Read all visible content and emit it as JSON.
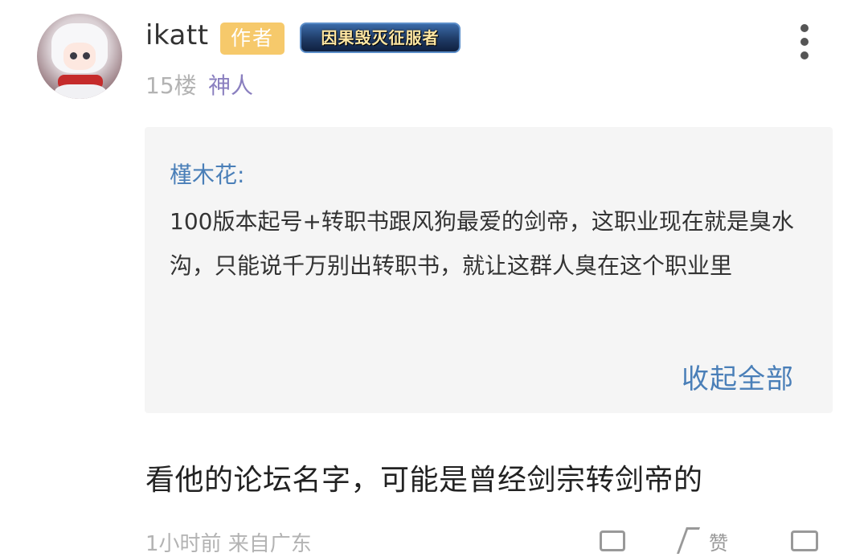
{
  "post": {
    "username": "ikatt",
    "author_badge": "作者",
    "title_badge": "因果毁灭征服者",
    "floor": "15楼",
    "level": "神人"
  },
  "quote": {
    "author": "槿木花:",
    "text": "100版本起号+转职书跟风狗最爱的剑帝，这职业现在就是臭水沟，只能说千万别出转职书，就让这群人臭在这个职业里",
    "collapse_label": "收起全部"
  },
  "reply": {
    "text": "看他的论坛名字，可能是曾经剑宗转剑帝的"
  },
  "footer": {
    "meta": "1小时前 来自广东",
    "like_label": "赞"
  },
  "icons": {
    "more": "more-vertical-icon",
    "comment": "comment-icon",
    "like": "thumbs-up-icon",
    "share": "share-icon"
  },
  "colors": {
    "link_blue": "#4a7fb8",
    "author_badge": "#f6c96b",
    "level_purple": "#8a7fbf",
    "muted_gray": "#b3b3b3"
  }
}
